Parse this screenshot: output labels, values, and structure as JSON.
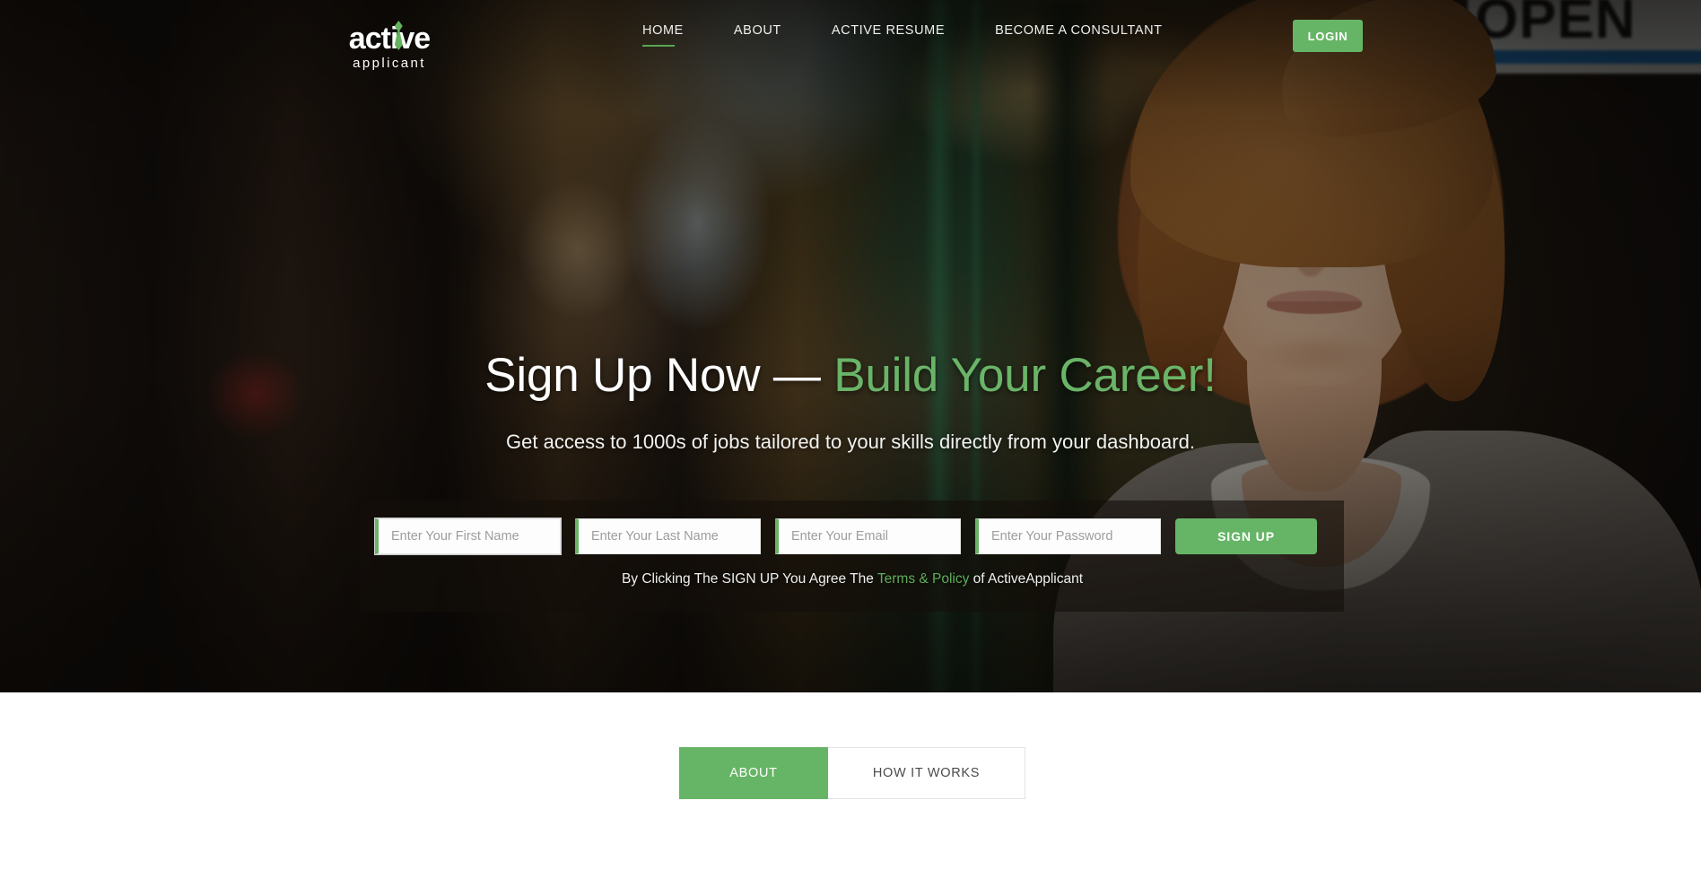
{
  "brand": {
    "logo_word": "active",
    "logo_sub": "applicant",
    "logo_icon": "green-tie-icon"
  },
  "header": {
    "nav": [
      {
        "label": "HOME",
        "active": true
      },
      {
        "label": "ABOUT",
        "active": false
      },
      {
        "label": "ACTIVE RESUME",
        "active": false
      },
      {
        "label": "BECOME A CONSULTANT",
        "active": false
      }
    ],
    "login_label": "LOGIN"
  },
  "hero": {
    "headline_white": "Sign Up Now — ",
    "headline_accent": "Build Your Career!",
    "subheadline": "Get access to 1000s of jobs tailored to your skills directly from your dashboard.",
    "background_sign_text": "OPEN"
  },
  "signup": {
    "fields": [
      {
        "name": "first-name",
        "placeholder": "Enter Your First Name",
        "value": ""
      },
      {
        "name": "last-name",
        "placeholder": "Enter Your Last Name",
        "value": ""
      },
      {
        "name": "email",
        "placeholder": "Enter Your Email",
        "value": ""
      },
      {
        "name": "password",
        "placeholder": "Enter Your Password",
        "value": ""
      }
    ],
    "button_label": "SIGN UP",
    "terms_prefix": "By Clicking The SIGN UP You Agree The ",
    "terms_link": "Terms & Policy",
    "terms_suffix": " of ActiveApplicant"
  },
  "tabs": [
    {
      "label": "ABOUT",
      "active": true
    },
    {
      "label": "HOW IT WORKS",
      "active": false
    }
  ],
  "colors": {
    "brand_green": "#66b566",
    "headline_green": "#6ab468",
    "link_green": "#5fae5c",
    "panel_overlay": "rgba(20,14,9,.62)",
    "page_background": "#ffffff"
  }
}
